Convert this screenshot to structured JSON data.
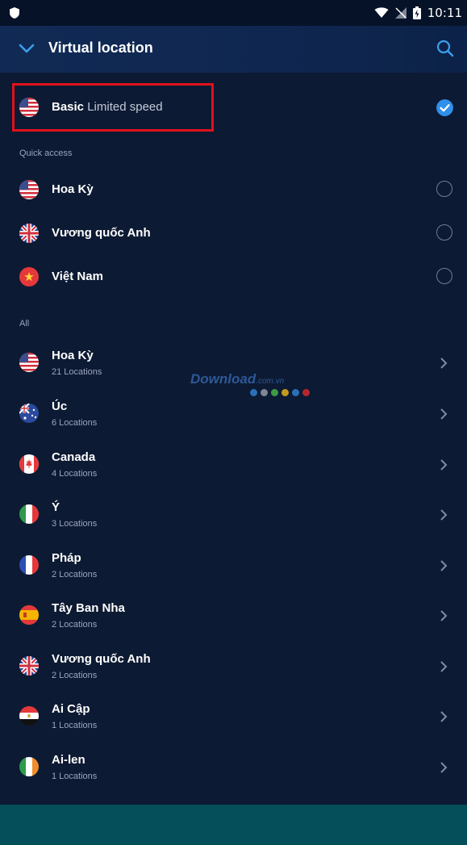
{
  "status_bar": {
    "time": "10:11"
  },
  "header": {
    "title": "Virtual location"
  },
  "basic": {
    "name": "Basic",
    "detail": "Limited speed"
  },
  "sections": {
    "quick": "Quick access",
    "all": "All"
  },
  "quick_access": [
    {
      "name": "Hoa Kỳ",
      "flag": "us"
    },
    {
      "name": "Vương quốc Anh",
      "flag": "uk"
    },
    {
      "name": "Việt Nam",
      "flag": "vn"
    }
  ],
  "all_locations": [
    {
      "name": "Hoa Kỳ",
      "count": "21 Locations",
      "flag": "us"
    },
    {
      "name": "Úc",
      "count": "6 Locations",
      "flag": "au"
    },
    {
      "name": "Canada",
      "count": "4 Locations",
      "flag": "ca"
    },
    {
      "name": "Ý",
      "count": "3 Locations",
      "flag": "it"
    },
    {
      "name": "Pháp",
      "count": "2 Locations",
      "flag": "fr"
    },
    {
      "name": "Tây Ban Nha",
      "count": "2 Locations",
      "flag": "es"
    },
    {
      "name": "Vương quốc Anh",
      "count": "2 Locations",
      "flag": "uk"
    },
    {
      "name": "Ai Cập",
      "count": "1 Locations",
      "flag": "eg"
    },
    {
      "name": "Ai-len",
      "count": "1 Locations",
      "flag": "ie"
    }
  ],
  "watermark": {
    "text": "Download",
    "suffix": ".com.vn"
  },
  "colors": {
    "accent": "#2f8fea",
    "background": "#0d1a33",
    "highlight": "#e0121b"
  }
}
